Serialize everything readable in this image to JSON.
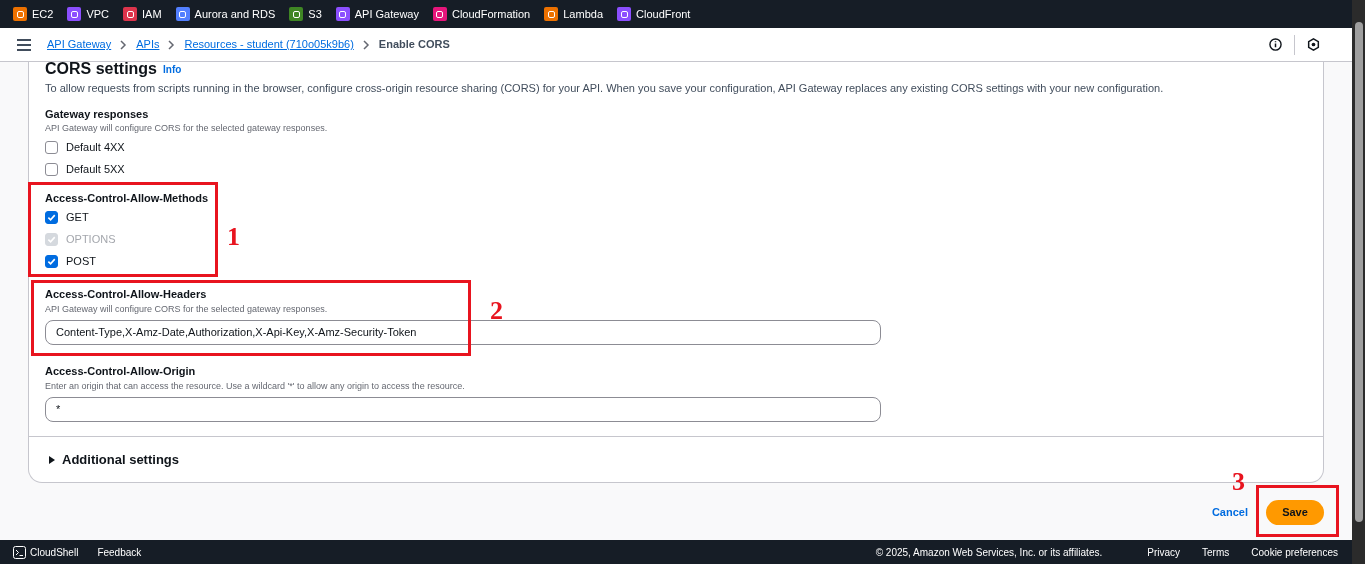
{
  "services": [
    {
      "label": "EC2",
      "color": "#ed7100"
    },
    {
      "label": "VPC",
      "color": "#8c4fff"
    },
    {
      "label": "IAM",
      "color": "#dd344c"
    },
    {
      "label": "Aurora and RDS",
      "color": "#527fff"
    },
    {
      "label": "S3",
      "color": "#3f8624"
    },
    {
      "label": "API Gateway",
      "color": "#8c4fff"
    },
    {
      "label": "CloudFormation",
      "color": "#e7157b"
    },
    {
      "label": "Lambda",
      "color": "#ed7100"
    },
    {
      "label": "CloudFront",
      "color": "#8c4fff"
    }
  ],
  "breadcrumbs": [
    {
      "label": "API Gateway",
      "kind": "link"
    },
    {
      "label": "APIs",
      "kind": "link"
    },
    {
      "label": "Resources - student (710o05k9b6)",
      "kind": "link"
    },
    {
      "label": "Enable CORS",
      "kind": "current"
    }
  ],
  "section": {
    "title": "CORS settings",
    "info": "Info",
    "description": "To allow requests from scripts running in the browser, configure cross-origin resource sharing (CORS) for your API. When you save your configuration, API Gateway replaces any existing CORS settings with your new configuration."
  },
  "gateway_responses": {
    "label": "Gateway responses",
    "hint": "API Gateway will configure CORS for the selected gateway responses.",
    "options": [
      {
        "label": "Default 4XX",
        "checked": false,
        "disabled": false
      },
      {
        "label": "Default 5XX",
        "checked": false,
        "disabled": false
      }
    ]
  },
  "methods": {
    "label": "Access-Control-Allow-Methods",
    "options": [
      {
        "label": "GET",
        "checked": true,
        "disabled": false
      },
      {
        "label": "OPTIONS",
        "checked": true,
        "disabled": true
      },
      {
        "label": "POST",
        "checked": true,
        "disabled": false
      }
    ]
  },
  "headers": {
    "label": "Access-Control-Allow-Headers",
    "hint": "API Gateway will configure CORS for the selected gateway responses.",
    "value": "Content-Type,X-Amz-Date,Authorization,X-Api-Key,X-Amz-Security-Token"
  },
  "origin": {
    "label": "Access-Control-Allow-Origin",
    "hint": "Enter an origin that can access the resource. Use a wildcard '*' to allow any origin to access the resource.",
    "value": "*"
  },
  "additional_settings": {
    "label": "Additional settings",
    "expanded": false
  },
  "actions": {
    "cancel": "Cancel",
    "save": "Save"
  },
  "footer": {
    "left": [
      "CloudShell",
      "Feedback"
    ],
    "copyright": "© 2025, Amazon Web Services, Inc. or its affiliates.",
    "links": [
      "Privacy",
      "Terms",
      "Cookie preferences"
    ]
  },
  "annotations": [
    "1",
    "2",
    "3"
  ]
}
